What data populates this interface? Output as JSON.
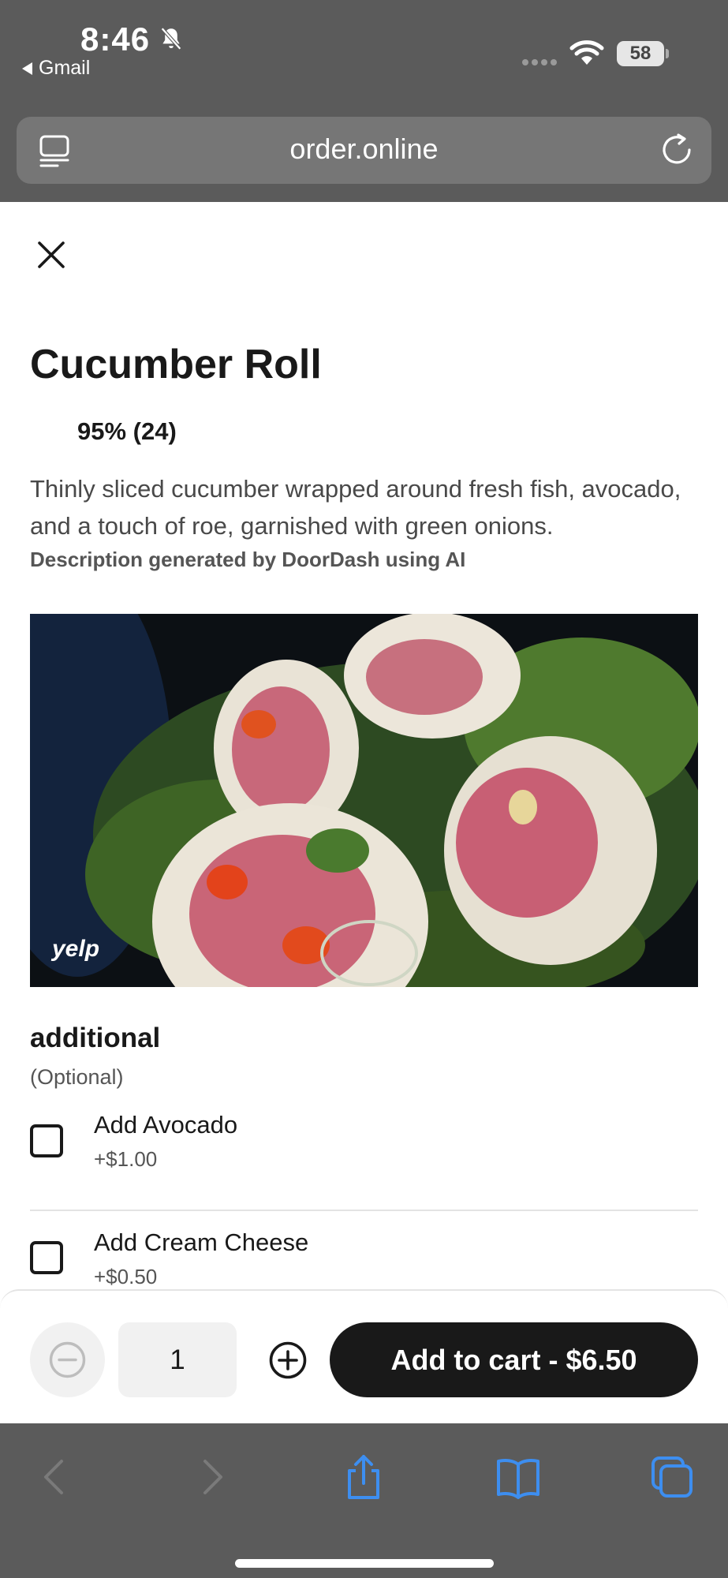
{
  "status_bar": {
    "time": "8:46",
    "back_app": "Gmail",
    "battery": "58"
  },
  "url_bar": {
    "url": "order.online"
  },
  "item": {
    "title": "Cucumber Roll",
    "rating": "95% (24)",
    "description": "Thinly sliced cucumber wrapped around fresh fish, avocado, and a touch of roe, garnished with green onions.",
    "ai_note": "Description generated by DoorDash using AI",
    "photo_credit": "yelp"
  },
  "options_group": {
    "title": "additional",
    "subtitle": "(Optional)",
    "options": [
      {
        "name": "Add Avocado",
        "price": "+$1.00"
      },
      {
        "name": "Add Cream Cheese",
        "price": "+$0.50"
      }
    ]
  },
  "action_bar": {
    "quantity": "1",
    "cart_label": "Add to cart - $6.50"
  },
  "colors": {
    "chrome_gray": "#5b5b5b",
    "primary_dark": "#191919",
    "safari_blue": "#3d8ef0"
  }
}
